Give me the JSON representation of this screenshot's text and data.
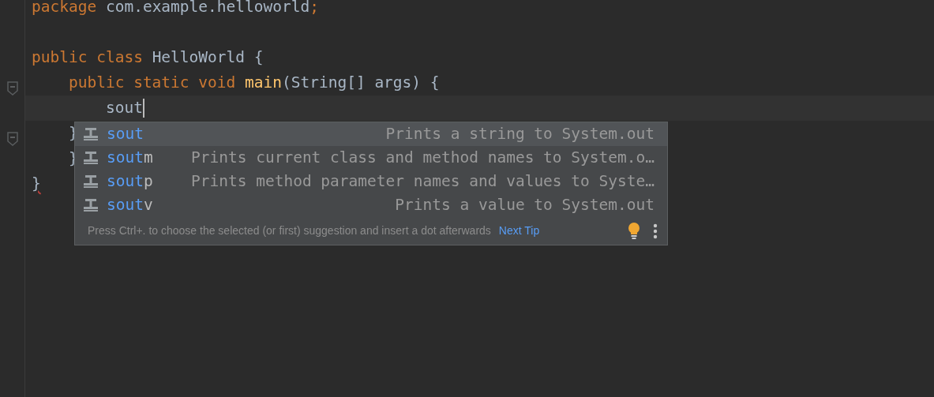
{
  "editor": {
    "lines": [
      {
        "tokens": [
          {
            "text": "package",
            "kind": "keyword"
          },
          {
            "text": " com.example.helloworld",
            "kind": "plain"
          },
          {
            "text": ";",
            "kind": "keyword"
          }
        ]
      },
      {
        "gap_before": true,
        "tokens": [
          {
            "text": "public class",
            "kind": "keyword"
          },
          {
            "text": " HelloWorld {",
            "kind": "plain"
          }
        ]
      },
      {
        "fold": true,
        "tokens": [
          {
            "text": "    public static void",
            "kind": "keyword"
          },
          {
            "text": " main",
            "kind": "method"
          },
          {
            "text": "(String[] args) {",
            "kind": "plain"
          }
        ]
      },
      {
        "current": true,
        "caret": true,
        "tokens": [
          {
            "text": "        sout",
            "kind": "plain"
          }
        ]
      },
      {
        "fold": true,
        "tokens": [
          {
            "text": "    }",
            "kind": "plain"
          }
        ]
      },
      {
        "tokens": [
          {
            "text": "    }",
            "kind": "plain"
          }
        ]
      },
      {
        "tokens": [
          {
            "text": "}",
            "kind": "error"
          }
        ]
      }
    ]
  },
  "completion": {
    "items": [
      {
        "match": "sout",
        "description": "Prints a string to System.out",
        "selected": true
      },
      {
        "match": "sout",
        "rest": "m",
        "description": "Prints current class and method names to System.o…",
        "selected": false
      },
      {
        "match": "sout",
        "rest": "p",
        "description": "Prints method parameter names and values to Syste…",
        "selected": false
      },
      {
        "match": "sout",
        "rest": "v",
        "description": "Prints a value to System.out",
        "selected": false
      }
    ],
    "hint": "Press Ctrl+. to choose the selected (or first) suggestion and insert a dot afterwards",
    "next_tip": "Next Tip"
  }
}
